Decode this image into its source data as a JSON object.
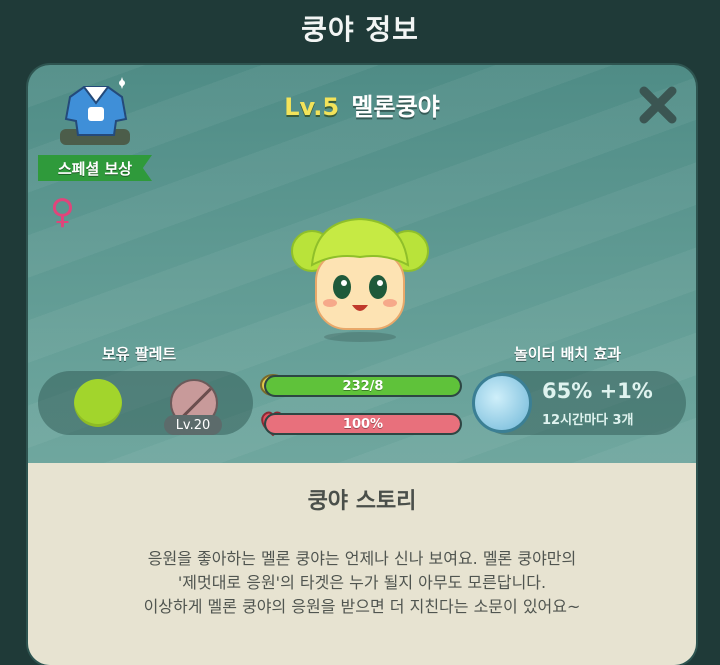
{
  "header": {
    "title": "쿵야 정보"
  },
  "reward": {
    "label": "스페셜 보상",
    "icon": "jacket-costume-icon"
  },
  "character": {
    "level": "Lv.5",
    "name": "멜론쿵야",
    "gender_icon": "female-icon"
  },
  "palette": {
    "title": "보유 팔레트",
    "colors": [
      "#a2d52c",
      "#c89a9a"
    ],
    "locked_level": "Lv.20"
  },
  "stats": {
    "food": {
      "text": "232/8",
      "icon": "turtle-food-icon",
      "fill": 1.0,
      "color": "#5fc23a"
    },
    "hp": {
      "text": "100%",
      "icon": "heart-icon",
      "fill": 1.0,
      "color": "#e8707c"
    }
  },
  "effect": {
    "title": "놀이터 배치 효과",
    "main": "65% +1%",
    "sub": "12시간마다 3개",
    "icon": "ice-pile-icon"
  },
  "story": {
    "title": "쿵야 스토리",
    "lines": [
      "응원을 좋아하는 멜론 쿵야는 언제나 신나 보여요. 멜론 쿵야만의",
      "'제멋대로 응원'의 타겟은 누가 될지 아무도 모른답니다.",
      "이상하게 멜론 쿵야의 응원을 받으면 더 지친다는 소문이 있어요~"
    ]
  }
}
